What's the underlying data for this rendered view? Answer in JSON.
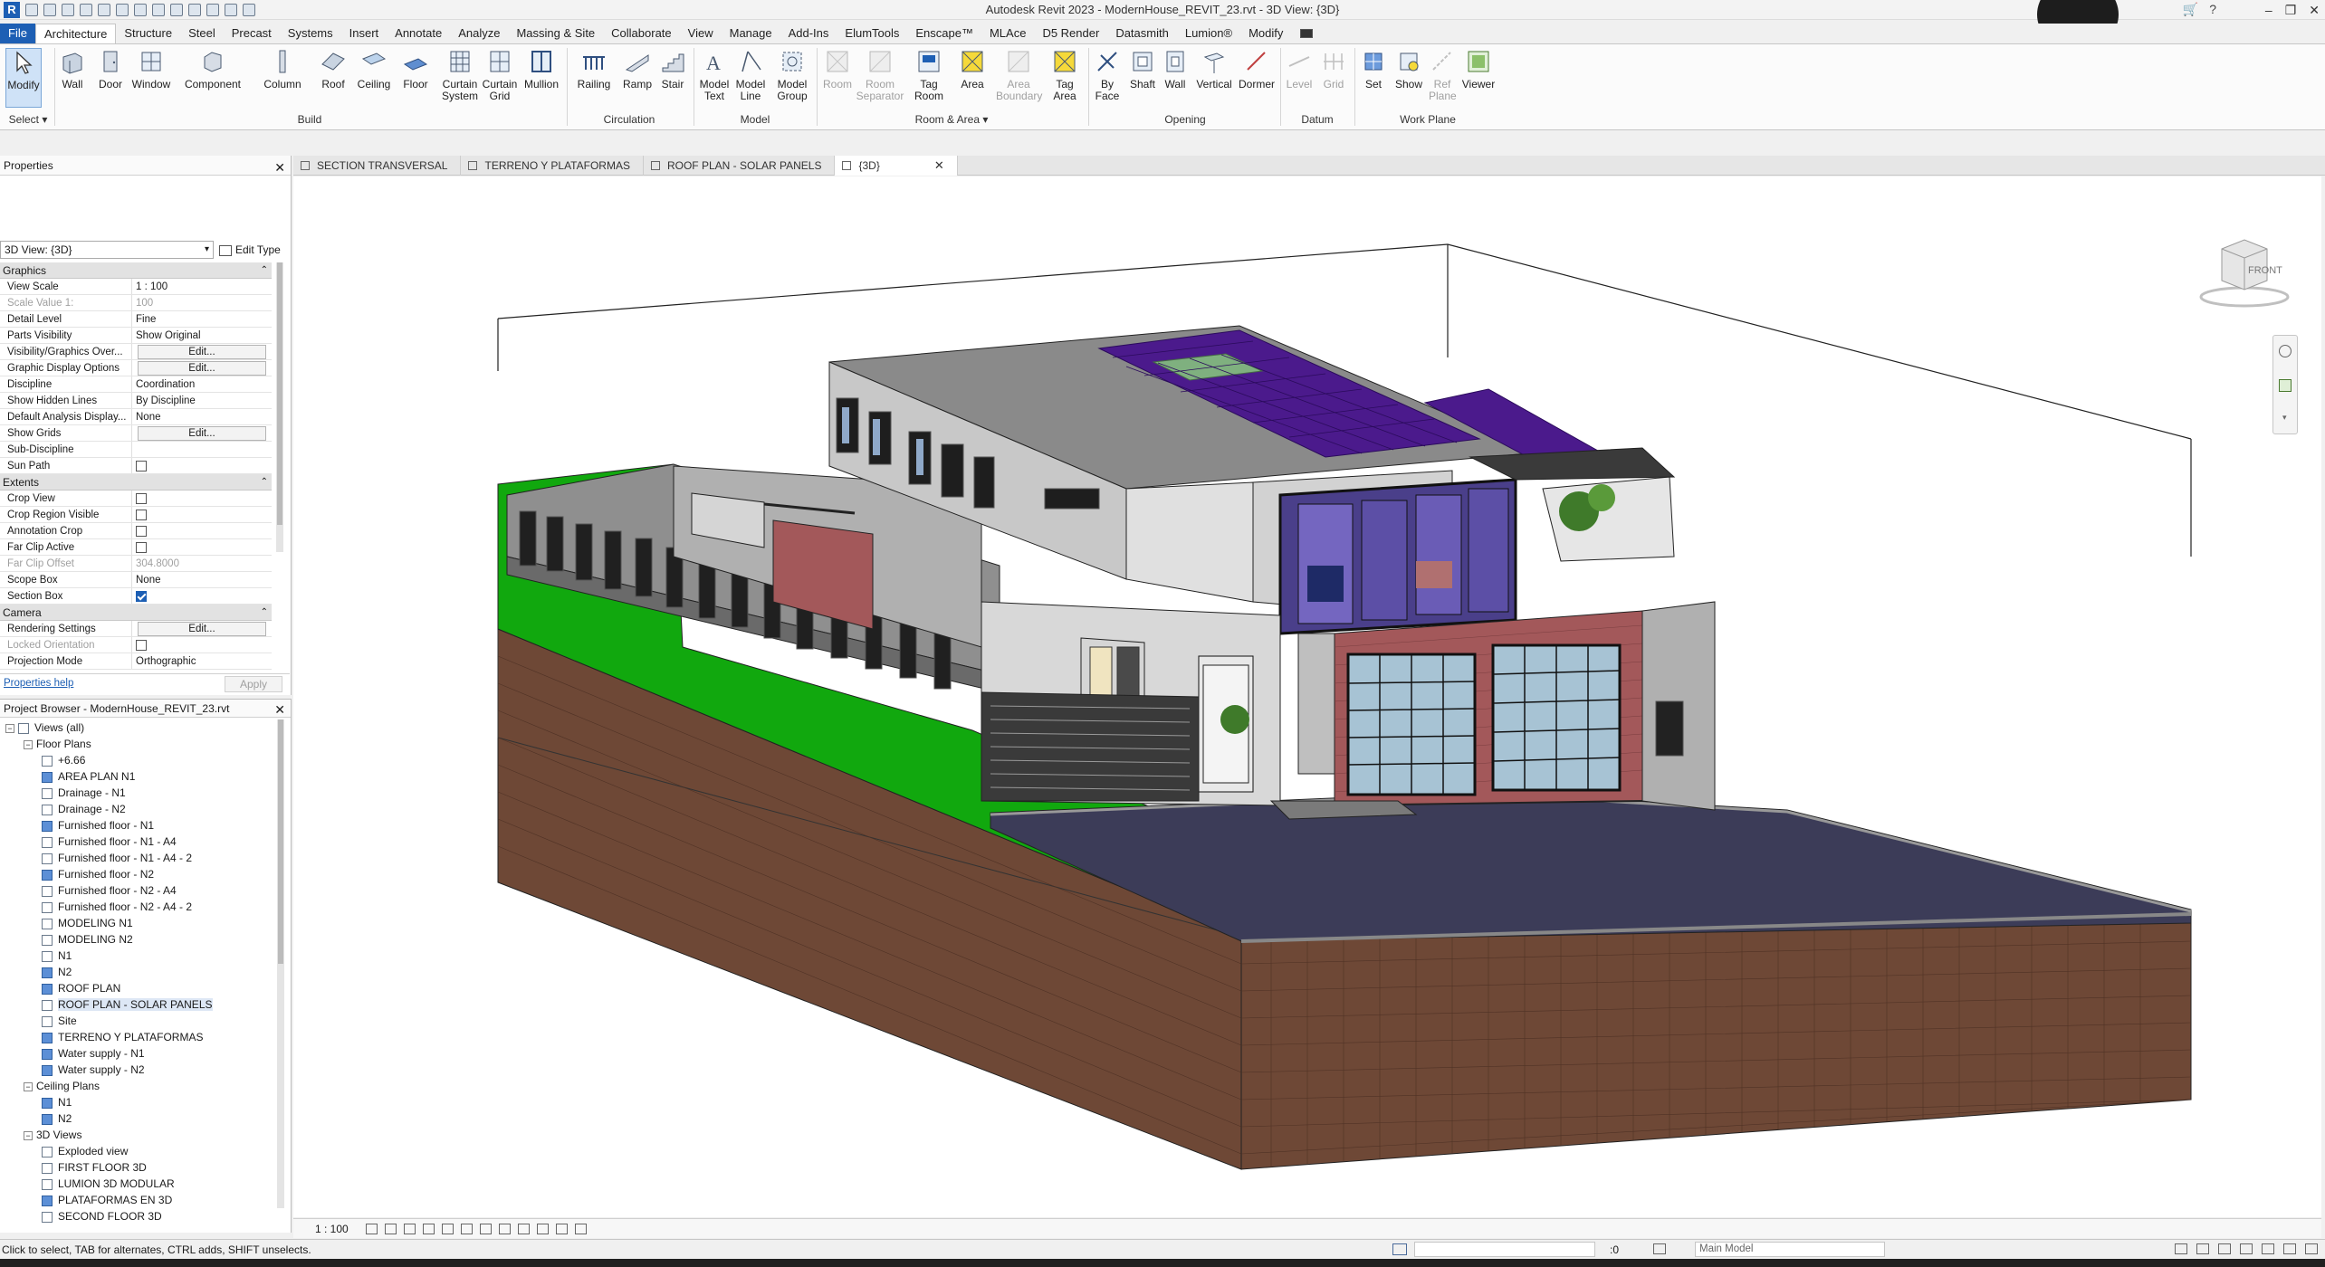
{
  "app": {
    "title": "Autodesk Revit 2023 - ModernHouse_REVIT_23.rvt - 3D View: {3D}",
    "logo": "R"
  },
  "ribbon_tabs": [
    "File",
    "Architecture",
    "Structure",
    "Steel",
    "Precast",
    "Systems",
    "Insert",
    "Annotate",
    "Analyze",
    "Massing & Site",
    "Collaborate",
    "View",
    "Manage",
    "Add-Ins",
    "ElumTools",
    "Enscape™",
    "MLAce",
    "D5 Render",
    "Datasmith",
    "Lumion®",
    "Modify"
  ],
  "ribbon": {
    "select_label": "Select",
    "panels": {
      "build": "Build",
      "circulation": "Circulation",
      "model": "Model",
      "room_area": "Room & Area",
      "opening": "Opening",
      "datum": "Datum",
      "work_plane": "Work Plane"
    },
    "buttons": {
      "modify": "Modify",
      "wall": "Wall",
      "door": "Door",
      "window": "Window",
      "component": "Component",
      "column": "Column",
      "roof": "Roof",
      "ceiling": "Ceiling",
      "floor": "Floor",
      "curtain_system_1": "Curtain",
      "curtain_system_2": "System",
      "curtain_grid_1": "Curtain",
      "curtain_grid_2": "Grid",
      "mullion": "Mullion",
      "railing": "Railing",
      "ramp": "Ramp",
      "stair": "Stair",
      "model_text_1": "Model",
      "model_text_2": "Text",
      "model_line_1": "Model",
      "model_line_2": "Line",
      "model_group_1": "Model",
      "model_group_2": "Group",
      "room": "Room",
      "room_sep_1": "Room",
      "room_sep_2": "Separator",
      "tag_room_1": "Tag",
      "tag_room_2": "Room",
      "area": "Area",
      "area_boundary_1": "Area",
      "area_boundary_2": "Boundary",
      "tag_area_1": "Tag",
      "tag_area_2": "Area",
      "by_face_1": "By",
      "by_face_2": "Face",
      "shaft": "Shaft",
      "op_wall": "Wall",
      "vertical": "Vertical",
      "dormer": "Dormer",
      "level": "Level",
      "grid": "Grid",
      "set": "Set",
      "show": "Show",
      "ref_plane_1": "Ref",
      "ref_plane_2": "Plane",
      "viewer": "Viewer"
    }
  },
  "properties": {
    "title": "Properties",
    "type_selector": "3D View: {3D}",
    "edit_type": "Edit Type",
    "sections": [
      {
        "name": "Graphics",
        "rows": [
          {
            "k": "View Scale",
            "v": "1 : 100",
            "kind": "text"
          },
          {
            "k": "Scale Value    1:",
            "v": "100",
            "kind": "text",
            "disabled": true
          },
          {
            "k": "Detail Level",
            "v": "Fine",
            "kind": "text"
          },
          {
            "k": "Parts Visibility",
            "v": "Show Original",
            "kind": "text"
          },
          {
            "k": "Visibility/Graphics Over...",
            "v": "Edit...",
            "kind": "button"
          },
          {
            "k": "Graphic Display Options",
            "v": "Edit...",
            "kind": "button"
          },
          {
            "k": "Discipline",
            "v": "Coordination",
            "kind": "text"
          },
          {
            "k": "Show Hidden Lines",
            "v": "By Discipline",
            "kind": "text"
          },
          {
            "k": "Default Analysis Display...",
            "v": "None",
            "kind": "text"
          },
          {
            "k": "Show Grids",
            "v": "Edit...",
            "kind": "button"
          },
          {
            "k": "Sub-Discipline",
            "v": "",
            "kind": "text"
          },
          {
            "k": "Sun Path",
            "v": "",
            "kind": "check",
            "checked": false
          }
        ]
      },
      {
        "name": "Extents",
        "rows": [
          {
            "k": "Crop View",
            "v": "",
            "kind": "check",
            "checked": false
          },
          {
            "k": "Crop Region Visible",
            "v": "",
            "kind": "check",
            "checked": false
          },
          {
            "k": "Annotation Crop",
            "v": "",
            "kind": "check",
            "checked": false
          },
          {
            "k": "Far Clip Active",
            "v": "",
            "kind": "check",
            "checked": false
          },
          {
            "k": "Far Clip Offset",
            "v": "304.8000",
            "kind": "text",
            "disabled": true
          },
          {
            "k": "Scope Box",
            "v": "None",
            "kind": "text"
          },
          {
            "k": "Section Box",
            "v": "",
            "kind": "check",
            "checked": true
          }
        ]
      },
      {
        "name": "Camera",
        "rows": [
          {
            "k": "Rendering Settings",
            "v": "Edit...",
            "kind": "button"
          },
          {
            "k": "Locked Orientation",
            "v": "",
            "kind": "check",
            "checked": false,
            "disabled": true
          },
          {
            "k": "Projection Mode",
            "v": "Orthographic",
            "kind": "text"
          }
        ]
      }
    ],
    "help_link": "Properties help",
    "apply": "Apply"
  },
  "browser": {
    "title": "Project Browser - ModernHouse_REVIT_23.rvt",
    "tree": [
      {
        "label": "Views (all)",
        "level": 0,
        "exp": "−",
        "icon": "views"
      },
      {
        "label": "Floor Plans",
        "level": 1,
        "exp": "−"
      },
      {
        "label": "+6.66",
        "level": 2,
        "blue": false
      },
      {
        "label": "AREA PLAN N1",
        "level": 2,
        "blue": true
      },
      {
        "label": "Drainage - N1",
        "level": 2,
        "blue": false
      },
      {
        "label": "Drainage - N2",
        "level": 2,
        "blue": false
      },
      {
        "label": "Furnished floor - N1",
        "level": 2,
        "blue": true
      },
      {
        "label": "Furnished floor - N1 - A4",
        "level": 2,
        "blue": false
      },
      {
        "label": "Furnished floor - N1 - A4 - 2",
        "level": 2,
        "blue": false
      },
      {
        "label": "Furnished floor - N2",
        "level": 2,
        "blue": true
      },
      {
        "label": "Furnished floor - N2 - A4",
        "level": 2,
        "blue": false
      },
      {
        "label": "Furnished floor - N2 - A4 - 2",
        "level": 2,
        "blue": false
      },
      {
        "label": "MODELING N1",
        "level": 2,
        "blue": false
      },
      {
        "label": "MODELING N2",
        "level": 2,
        "blue": false
      },
      {
        "label": "N1",
        "level": 2,
        "blue": false
      },
      {
        "label": "N2",
        "level": 2,
        "blue": true
      },
      {
        "label": "ROOF PLAN",
        "level": 2,
        "blue": true
      },
      {
        "label": "ROOF PLAN - SOLAR PANELS",
        "level": 2,
        "blue": false,
        "selected": true
      },
      {
        "label": "Site",
        "level": 2,
        "blue": false
      },
      {
        "label": "TERRENO Y PLATAFORMAS",
        "level": 2,
        "blue": true
      },
      {
        "label": "Water supply - N1",
        "level": 2,
        "blue": true
      },
      {
        "label": "Water supply - N2",
        "level": 2,
        "blue": true
      },
      {
        "label": "Ceiling Plans",
        "level": 1,
        "exp": "−"
      },
      {
        "label": "N1",
        "level": 2,
        "blue": true
      },
      {
        "label": "N2",
        "level": 2,
        "blue": true
      },
      {
        "label": "3D Views",
        "level": 1,
        "exp": "−"
      },
      {
        "label": "Exploded view",
        "level": 2,
        "blue": false
      },
      {
        "label": "FIRST FLOOR 3D",
        "level": 2,
        "blue": false
      },
      {
        "label": "LUMION 3D MODULAR",
        "level": 2,
        "blue": false
      },
      {
        "label": "PLATAFORMAS EN 3D",
        "level": 2,
        "blue": true
      },
      {
        "label": "SECOND FLOOR 3D",
        "level": 2,
        "blue": false
      }
    ]
  },
  "view_tabs": [
    {
      "label": "SECTION TRANSVERSAL",
      "active": false
    },
    {
      "label": "TERRENO Y PLATAFORMAS",
      "active": false
    },
    {
      "label": "ROOF PLAN - SOLAR PANELS",
      "active": false
    },
    {
      "label": "{3D}",
      "active": true
    }
  ],
  "viewcube": {
    "face": "FRONT"
  },
  "view_control": {
    "scale": "1 : 100"
  },
  "status": {
    "message": "Click to select, TAB for alternates, CTRL adds, SHIFT unselects.",
    "count": ":0",
    "model": "Main Model"
  },
  "colors": {
    "brand": "#1d5fb4",
    "solar": "#4b1a8c",
    "grass": "#11a80e",
    "brick": "#a3585a",
    "earth": "#6e4836",
    "pavement": "#3c3c58"
  }
}
